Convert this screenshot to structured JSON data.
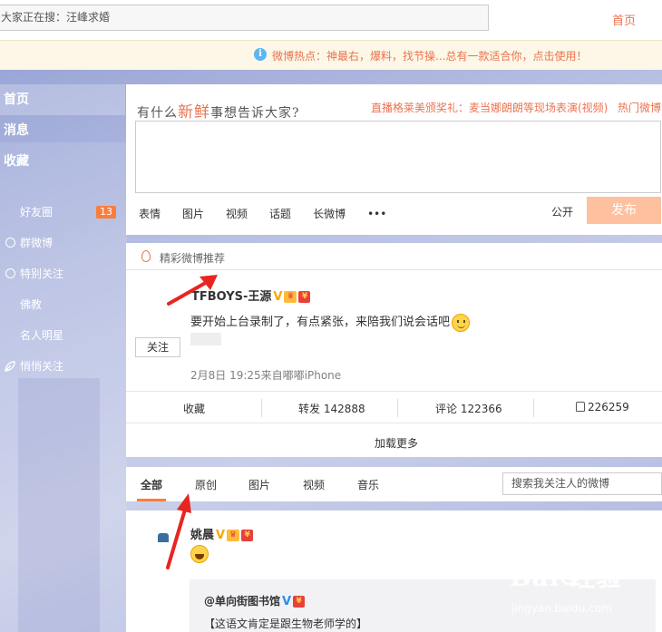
{
  "top": {
    "search_text": "大家正在搜：汪峰求婚",
    "home_label": "首页"
  },
  "notice": {
    "icon": "info-icon",
    "text": "微博热点：神最右，爆料，找节操...总有一款适合你，点击使用！"
  },
  "sidebar": {
    "main_items": [
      {
        "label": "首页"
      },
      {
        "label": "消息"
      },
      {
        "label": "收藏"
      }
    ],
    "sub_items": [
      {
        "label": "好友圈",
        "badge": "13"
      },
      {
        "label": "群微博",
        "icon": "group-icon"
      },
      {
        "label": "特别关注",
        "icon": "special-follow-icon"
      },
      {
        "label": "佛教"
      },
      {
        "label": "名人明星"
      },
      {
        "label": "悄悄关注",
        "icon": "leaf-icon"
      }
    ]
  },
  "publisher": {
    "prompt_pre": "有什么",
    "prompt_highlight": "新鲜",
    "prompt_post": "事想告诉大家?",
    "hot_topic": "直播格莱美颁奖礼：麦当娜朗朗等现场表演(视频)",
    "hot_topic2": "热门微博",
    "tools": [
      "表情",
      "图片",
      "视频",
      "话题",
      "长微博",
      "•••"
    ],
    "visibility": "公开",
    "submit_label": "发布"
  },
  "featured": {
    "header": "精彩微博推荐",
    "author": "TFBOYS-王源",
    "v_badge": "V",
    "text": "要开始上台录制了，有点紧张，来陪我们说会话吧",
    "follow_label": "关注",
    "time": "2月8日 19:25来自嘟嘟iPhone",
    "actions": {
      "favorite": "收藏",
      "repost": "转发 142888",
      "comment": "评论 122366",
      "like": "226259"
    },
    "load_more": "加载更多"
  },
  "feed_tabs": {
    "tabs": [
      "全部",
      "原创",
      "图片",
      "视频",
      "音乐"
    ],
    "search_placeholder": "搜索我关注人的微博"
  },
  "feed_post": {
    "author": "姚晨",
    "v_badge": "V",
    "repost_author": "@单向街图书馆",
    "repost_v": "V",
    "repost_text": "【这语文肯定是跟生物老师学的】"
  },
  "watermark": {
    "main": "Bai  经验",
    "sub": "jingyan.baidu.com"
  },
  "colors": {
    "accent": "#eb7350",
    "badge": "#fa7d3c",
    "submit_disabled": "#ffc09f",
    "arrow": "#e8251f"
  }
}
